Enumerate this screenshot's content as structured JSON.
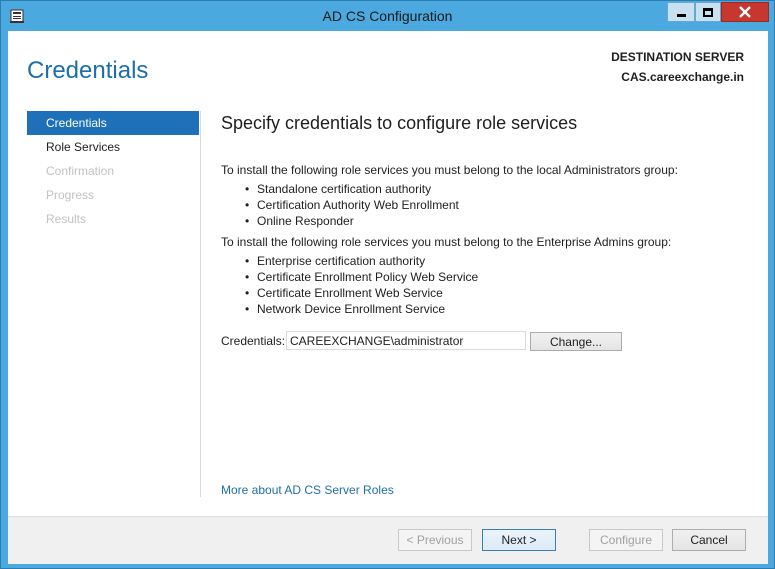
{
  "window": {
    "title": "AD CS Configuration",
    "accent_color": "#4ca9df",
    "close_color": "#c7372f",
    "app_icon": "server-manager-icon"
  },
  "header": {
    "page_heading": "Credentials",
    "destination_label": "DESTINATION SERVER",
    "destination_server": "CAS.careexchange.in"
  },
  "nav": {
    "items": [
      {
        "label": "Credentials",
        "state": "active"
      },
      {
        "label": "Role Services",
        "state": "enabled"
      },
      {
        "label": "Confirmation",
        "state": "disabled"
      },
      {
        "label": "Progress",
        "state": "disabled"
      },
      {
        "label": "Results",
        "state": "disabled"
      }
    ],
    "active_color": "#1e70b8"
  },
  "main": {
    "title": "Specify credentials to configure role services",
    "local_admin_intro": "To install the following role services you must belong to the local Administrators group:",
    "local_admin_services": [
      "Standalone certification authority",
      "Certification Authority Web Enrollment",
      "Online Responder"
    ],
    "enterprise_admin_intro": "To install the following role services you must belong to the Enterprise Admins group:",
    "enterprise_admin_services": [
      "Enterprise certification authority",
      "Certificate Enrollment Policy Web Service",
      "Certificate Enrollment Web Service",
      "Network Device Enrollment Service"
    ],
    "credentials_label": "Credentials:",
    "credentials_value": "CAREEXCHANGE\\administrator",
    "change_button": "Change...",
    "more_link": "More about AD CS Server Roles",
    "link_color": "#1e6fa8"
  },
  "footer": {
    "previous_button": "< Previous",
    "next_button": "Next >",
    "configure_button": "Configure",
    "cancel_button": "Cancel"
  }
}
